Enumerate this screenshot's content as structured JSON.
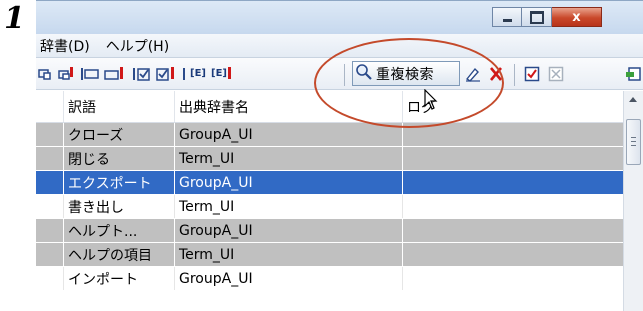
{
  "step_number": "1",
  "window": {
    "buttons": {
      "minimize": "minimize",
      "maximize": "maximize",
      "close": "x"
    }
  },
  "menu": [
    {
      "label": "辞書(D)"
    },
    {
      "label": "ヘルプ(H)"
    }
  ],
  "toolbar": {
    "tag_e_label": "[E]",
    "tag_e2_label": "[E]",
    "duplicate_search_label": "重複検索"
  },
  "table": {
    "columns": [
      "訳語",
      "出典辞書名",
      "ログ"
    ],
    "rows": [
      {
        "term": "クローズ",
        "dictionary": "GroupA_UI",
        "log": "",
        "state": "gray"
      },
      {
        "term": "閉じる",
        "dictionary": "Term_UI",
        "log": "",
        "state": "gray"
      },
      {
        "term": "エクスポート",
        "dictionary": "GroupA_UI",
        "log": "",
        "state": "selected"
      },
      {
        "term": "書き出し",
        "dictionary": "Term_UI",
        "log": "",
        "state": "white"
      },
      {
        "term": "ヘルプト...",
        "dictionary": "GroupA_UI",
        "log": "",
        "state": "gray"
      },
      {
        "term": "ヘルプの項目",
        "dictionary": "Term_UI",
        "log": "",
        "state": "gray"
      },
      {
        "term": "インポート",
        "dictionary": "GroupA_UI",
        "log": "",
        "state": "white"
      }
    ]
  },
  "colors": {
    "selection": "#316ac5",
    "row_gray": "#c0c0c0",
    "annotation": "#c44a2b"
  }
}
